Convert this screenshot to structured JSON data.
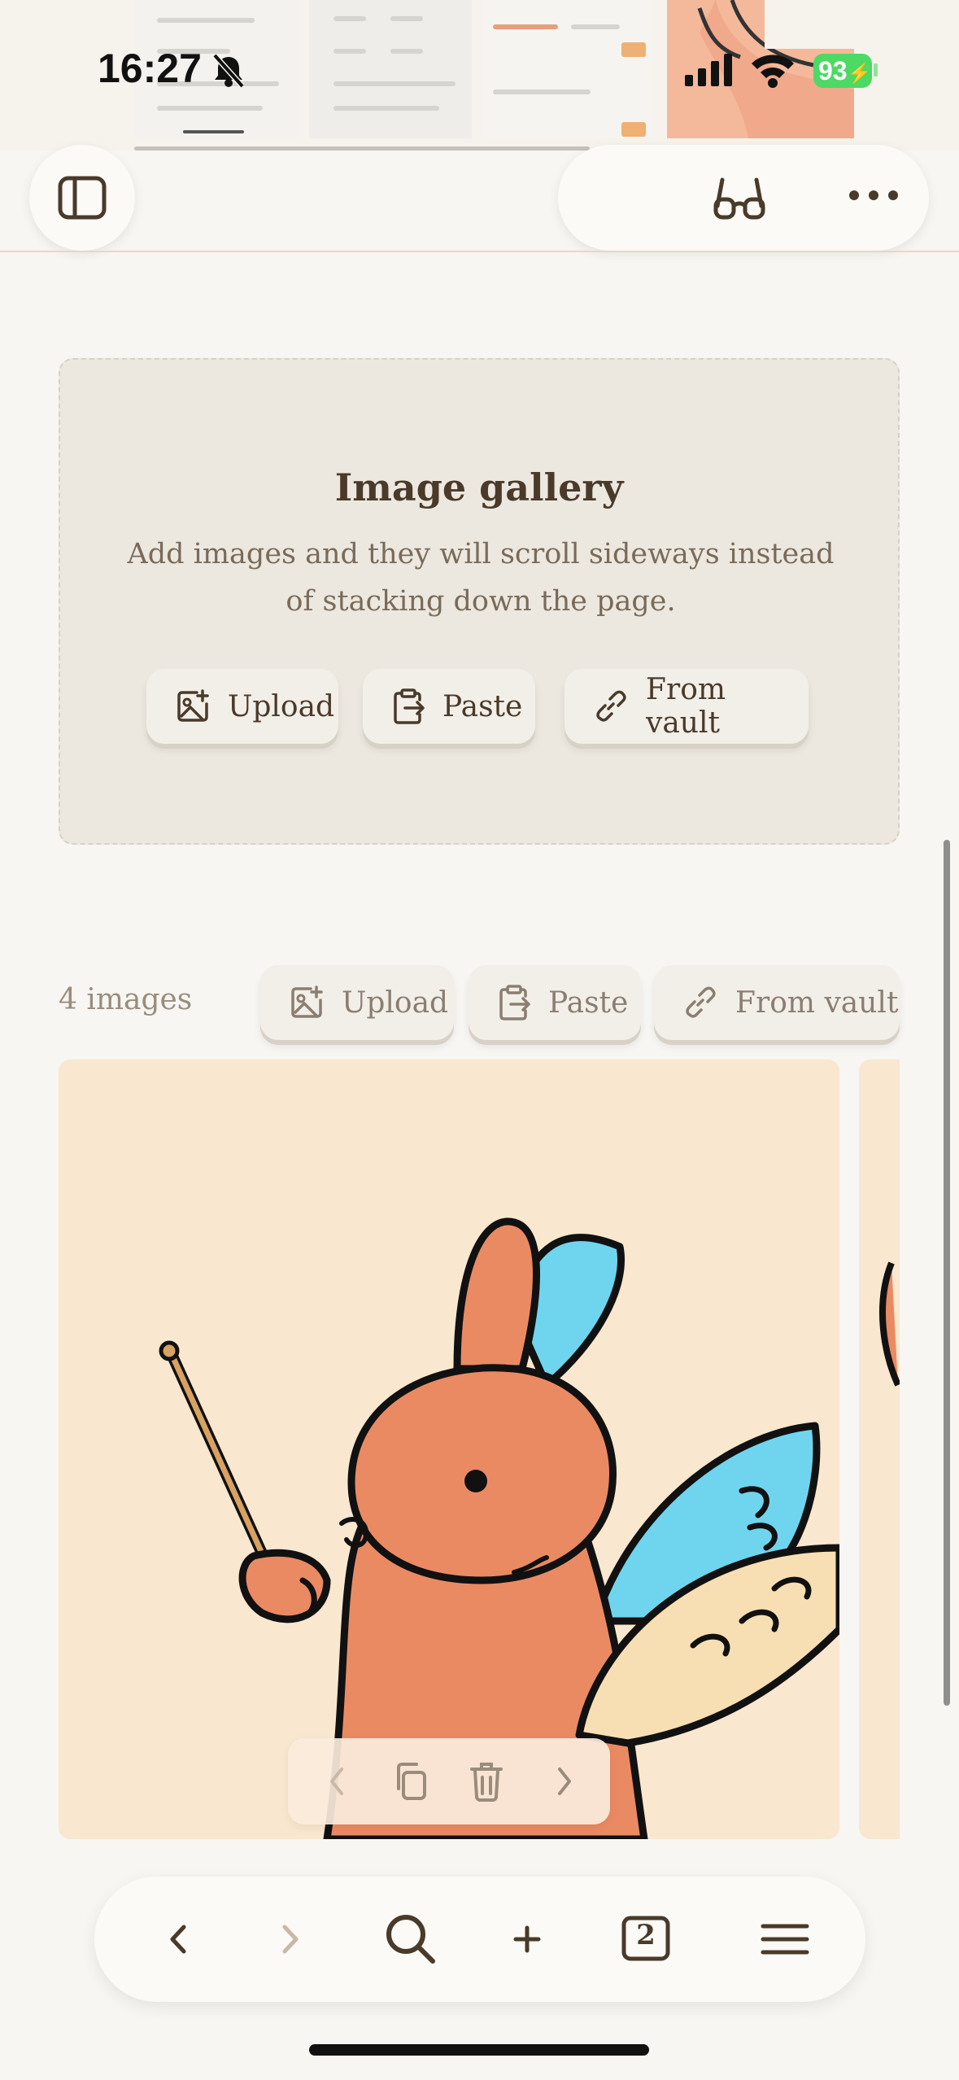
{
  "status_bar": {
    "time": "16:27",
    "battery": "93"
  },
  "toolbar": {
    "sidebar_icon": "sidebar-toggle-icon",
    "reader_icon": "reader-mode-icon",
    "more_icon": "more-options-icon"
  },
  "gallery_empty": {
    "title": "Image gallery",
    "description": "Add images and they will scroll sideways instead of stacking down the page.",
    "buttons": {
      "upload": "Upload",
      "paste": "Paste",
      "from_vault": "From vault"
    }
  },
  "gallery": {
    "count_label": "4 images",
    "buttons": {
      "upload": "Upload",
      "paste": "Paste",
      "from_vault": "From vault"
    },
    "controls": [
      "previous-icon",
      "copy-icon",
      "trash-icon",
      "next-icon"
    ]
  },
  "bottom_nav": {
    "tab_count": "2",
    "items": [
      "back-icon",
      "forward-icon",
      "search-icon",
      "new-tab-icon",
      "tabs-icon",
      "menu-icon"
    ]
  },
  "colors": {
    "background": "#f7f6f3",
    "card": "#ece8e0",
    "text": "#4a3a2a",
    "rabbit": "#ea8a63",
    "wing_blue": "#6fd5ef"
  }
}
